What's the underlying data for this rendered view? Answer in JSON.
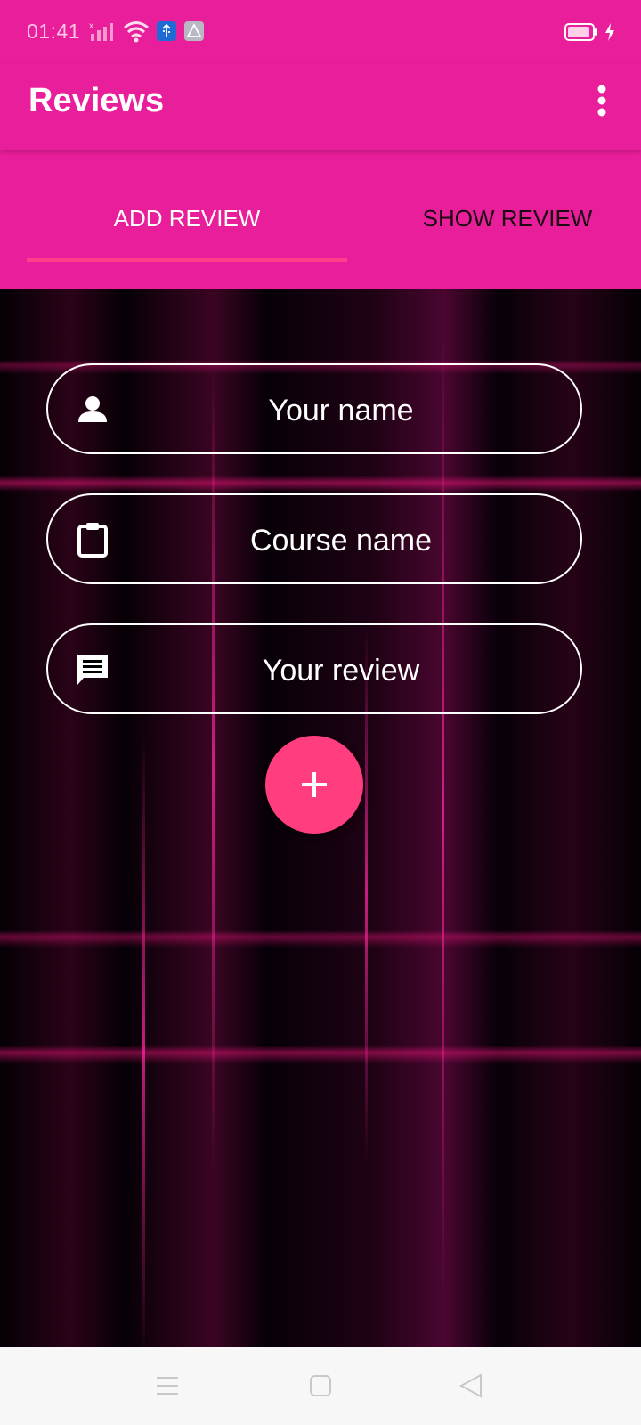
{
  "status_bar": {
    "time": "01:41",
    "icons": [
      "signal-icon",
      "wifi-icon",
      "usb-icon",
      "drive-icon",
      "battery-icon",
      "charging-icon"
    ]
  },
  "app_bar": {
    "title": "Reviews",
    "menu_icon": "more-vert-icon"
  },
  "tabs": [
    {
      "label": "ADD REVIEW",
      "selected": true
    },
    {
      "label": "SHOW REVIEW",
      "selected": false
    }
  ],
  "form": {
    "fields": [
      {
        "icon": "person-icon",
        "placeholder": "Your name",
        "value": ""
      },
      {
        "icon": "clipboard-icon",
        "placeholder": "Course name",
        "value": ""
      },
      {
        "icon": "chat-icon",
        "placeholder": "Your review",
        "value": ""
      }
    ],
    "add_button_icon": "plus-icon"
  },
  "nav_bar": {
    "icons": [
      "menu-icon",
      "home-square-icon",
      "back-triangle-icon"
    ]
  },
  "colors": {
    "primary": "#e91e9a",
    "accent": "#ff3d7f",
    "tab_unselected": "#1a0a12"
  }
}
